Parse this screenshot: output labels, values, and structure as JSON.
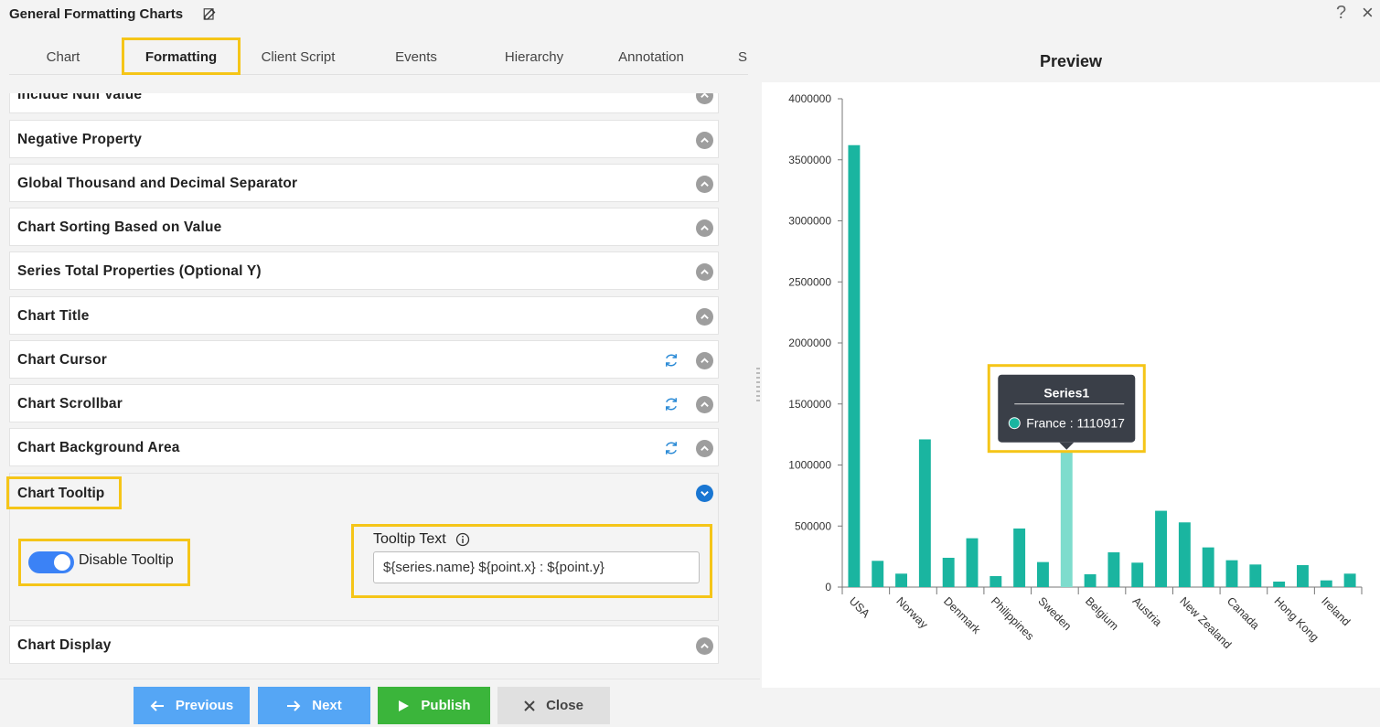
{
  "window": {
    "title": "General Formatting Charts",
    "help": "?",
    "close": "×"
  },
  "tabs": [
    {
      "label": "Chart"
    },
    {
      "label": "Formatting"
    },
    {
      "label": "Client Script"
    },
    {
      "label": "Events"
    },
    {
      "label": "Hierarchy"
    },
    {
      "label": "Annotation"
    },
    {
      "label": "S"
    }
  ],
  "sections": [
    {
      "label": "Include Null Value"
    },
    {
      "label": "Negative Property"
    },
    {
      "label": "Global Thousand and Decimal Separator"
    },
    {
      "label": "Chart Sorting Based on Value"
    },
    {
      "label": "Series Total Properties (Optional Y)"
    },
    {
      "label": "Chart Title"
    },
    {
      "label": "Chart Cursor"
    },
    {
      "label": "Chart Scrollbar"
    },
    {
      "label": "Chart Background Area"
    },
    {
      "label": "Chart Tooltip"
    },
    {
      "label": "Chart Display"
    }
  ],
  "tooltip": {
    "toggle_label": "Disable Tooltip",
    "toggle_on": true,
    "text_label": "Tooltip Text",
    "text_value": "${series.name} ${point.x} : ${point.y}"
  },
  "footer": {
    "previous": "Previous",
    "next": "Next",
    "publish": "Publish",
    "close": "Close"
  },
  "preview": {
    "title": "Preview",
    "hover_tooltip": {
      "series": "Series1",
      "text": "France : 1110917"
    }
  },
  "colors": {
    "bar": "#1ab5a0",
    "bar_hover": "#7edccd",
    "highlight": "#f5c518",
    "toggle": "#3b82f6"
  },
  "chart_data": {
    "type": "bar",
    "categories": [
      "USA",
      "",
      "Norway",
      "",
      "Denmark",
      "",
      "Philippines",
      "",
      "Sweden",
      "",
      "Belgium",
      "",
      "Austria",
      "",
      "New Zealand",
      "",
      "Canada",
      "",
      "Hong Kong",
      "",
      "Ireland",
      ""
    ],
    "values": [
      3620000,
      215000,
      110000,
      1210000,
      240000,
      400000,
      90000,
      480000,
      205000,
      1110917,
      105000,
      285000,
      200000,
      625000,
      530000,
      325000,
      220000,
      185000,
      45000,
      180000,
      55000,
      110000
    ],
    "hover_index": 9,
    "ylim": [
      0,
      4000000
    ],
    "yticks": [
      "0",
      "500000",
      "1000000",
      "1500000",
      "2000000",
      "2500000",
      "3000000",
      "3500000",
      "4000000"
    ],
    "ytick_values": [
      0,
      500000,
      1000000,
      1500000,
      2000000,
      2500000,
      3000000,
      3500000,
      4000000
    ],
    "series": [
      {
        "name": "Series1"
      }
    ]
  }
}
